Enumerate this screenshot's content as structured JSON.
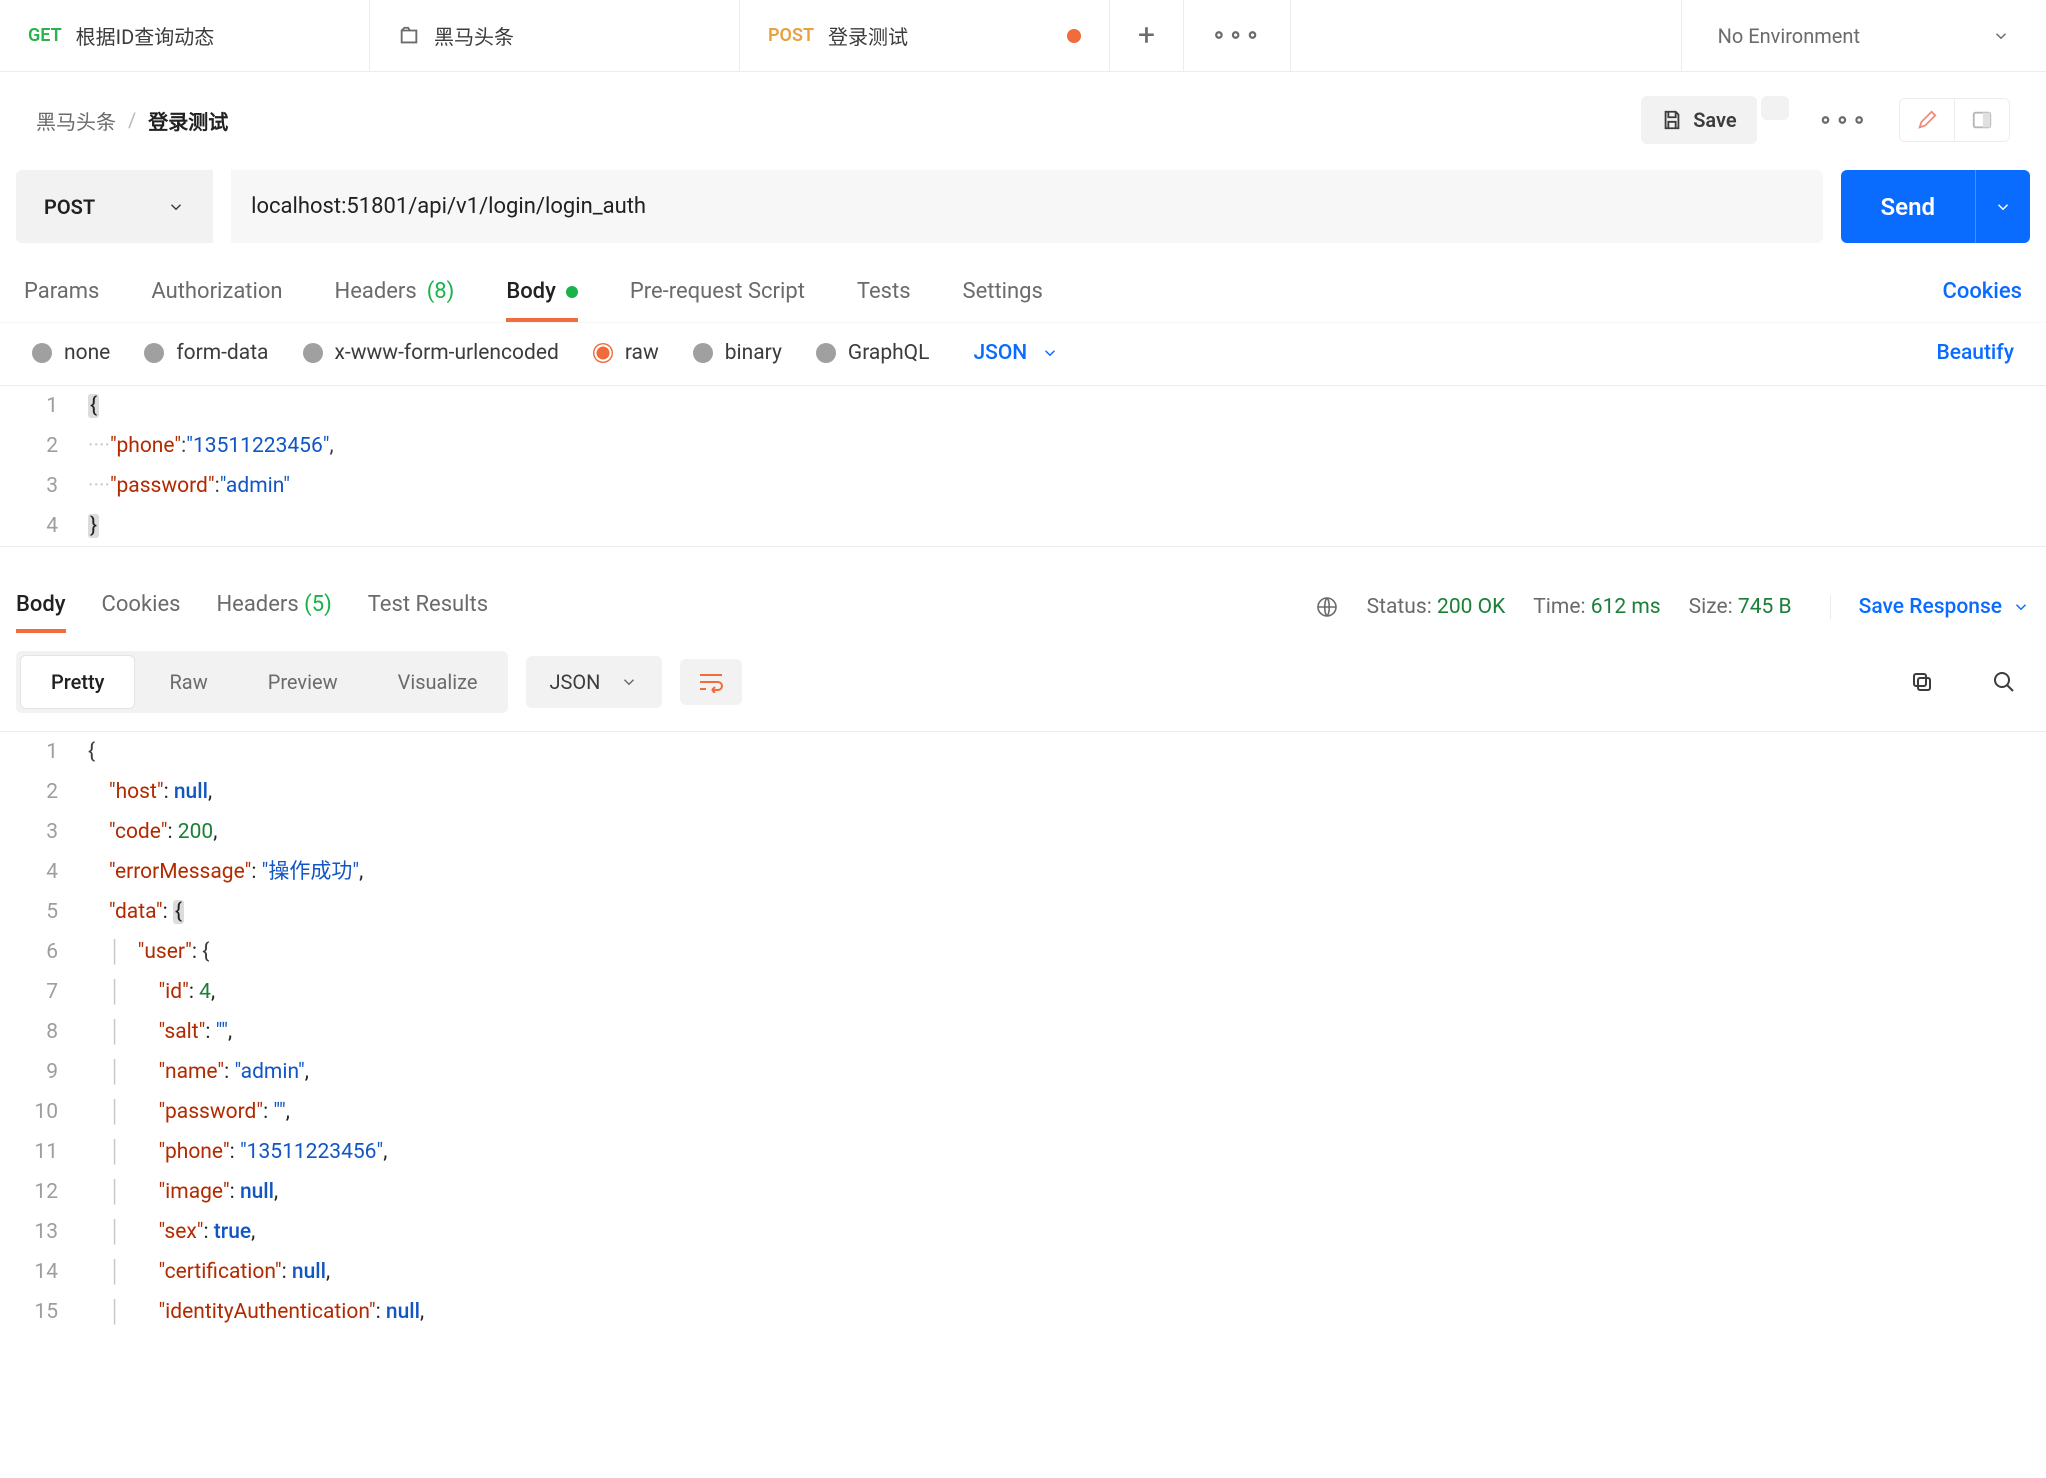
{
  "tabs": {
    "t0": {
      "method": "GET",
      "title": "根据ID查询动态"
    },
    "t1": {
      "title": "黑马头条"
    },
    "t2": {
      "method": "POST",
      "title": "登录测试"
    }
  },
  "environment": "No Environment",
  "breadcrumb": {
    "folder": "黑马头条",
    "name": "登录测试"
  },
  "actions": {
    "save": "Save"
  },
  "request": {
    "method": "POST",
    "url": "localhost:51801/api/v1/login/login_auth",
    "send": "Send",
    "tabs": {
      "params": "Params",
      "auth": "Authorization",
      "headers": "Headers",
      "headers_count": "(8)",
      "body": "Body",
      "prerequest": "Pre-request Script",
      "tests": "Tests",
      "settings": "Settings",
      "cookies_link": "Cookies"
    },
    "body_types": {
      "none": "none",
      "formdata": "form-data",
      "xwww": "x-www-form-urlencoded",
      "raw": "raw",
      "binary": "binary",
      "graphql": "GraphQL",
      "format": "JSON",
      "beautify": "Beautify"
    },
    "body_json": {
      "phone": "13511223456",
      "password": "admin"
    }
  },
  "response": {
    "tabs": {
      "body": "Body",
      "cookies": "Cookies",
      "headers": "Headers",
      "headers_count": "(5)",
      "testresults": "Test Results"
    },
    "status_label": "Status:",
    "status_value": "200 OK",
    "time_label": "Time:",
    "time_value": "612 ms",
    "size_label": "Size:",
    "size_value": "745 B",
    "save": "Save Response",
    "toolbar": {
      "pretty": "Pretty",
      "raw": "Raw",
      "preview": "Preview",
      "visualize": "Visualize",
      "format": "JSON"
    },
    "body": {
      "host": null,
      "code": 200,
      "errorMessage": "操作成功",
      "data": {
        "user": {
          "id": 4,
          "salt": "",
          "name": "admin",
          "password": "",
          "phone": "13511223456",
          "image": null,
          "sex": true,
          "certification": null,
          "identityAuthentication": null
        }
      }
    }
  }
}
